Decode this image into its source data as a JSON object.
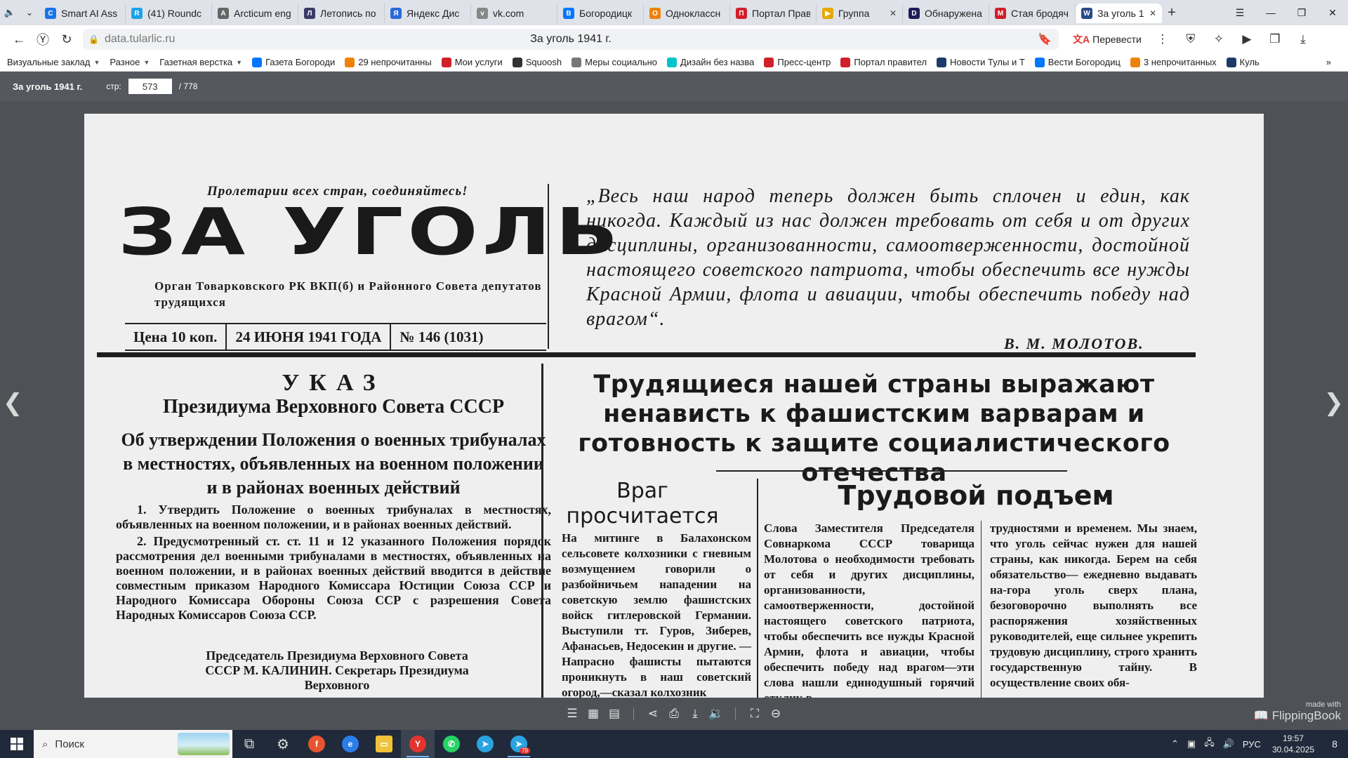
{
  "browser": {
    "tabs": [
      {
        "title": "Smart AI Ass",
        "icon_color": "#1a73e8",
        "icon": "C"
      },
      {
        "title": "(41) Roundc",
        "icon_color": "#1aa3e8",
        "icon": "R"
      },
      {
        "title": "Arcticum eng",
        "icon_color": "#666666",
        "icon": "A"
      },
      {
        "title": "Летопись по",
        "icon_color": "#3a3a6a",
        "icon": "Л"
      },
      {
        "title": "Яндекс Дис",
        "icon_color": "#2a6ad8",
        "icon": "Я"
      },
      {
        "title": "vk.com",
        "icon_color": "#888888",
        "icon": "v"
      },
      {
        "title": "Богородицк",
        "icon_color": "#0077ff",
        "icon": "В"
      },
      {
        "title": "Одноклассн",
        "icon_color": "#ee8208",
        "icon": "О"
      },
      {
        "title": "Портал Прав",
        "icon_color": "#d0202a",
        "icon": "П"
      },
      {
        "title": "Группа",
        "icon_color": "#e5a800",
        "icon": "▶"
      },
      {
        "title": "Обнаружена",
        "icon_color": "#1d1d5a",
        "icon": "D"
      },
      {
        "title": "Стая бродяч",
        "icon_color": "#d0202a",
        "icon": "M"
      },
      {
        "title": "За уголь 1",
        "icon_color": "#2a4a8a",
        "icon": "W"
      }
    ],
    "window_controls": {
      "menu": "☰",
      "minimize": "—",
      "restore": "❐",
      "close": "✕"
    },
    "address": {
      "url": "data.tularlic.ru",
      "page_title": "За уголь 1941 г.",
      "translate_label": "Перевести"
    },
    "bookmarks": [
      {
        "label": "Визуальные заклад",
        "dropdown": true,
        "icon_color": ""
      },
      {
        "label": "Разное",
        "dropdown": true,
        "icon_color": ""
      },
      {
        "label": "Газетная верстка",
        "dropdown": true,
        "icon_color": ""
      },
      {
        "label": "Газета Богороди",
        "dropdown": false,
        "icon_color": "#0077ff"
      },
      {
        "label": "29 непрочитанны",
        "dropdown": false,
        "icon_color": "#ee8208"
      },
      {
        "label": "Мои услуги",
        "dropdown": false,
        "icon_color": "#d0202a"
      },
      {
        "label": "Squoosh",
        "dropdown": false,
        "icon_color": "#333333"
      },
      {
        "label": "Меры социально",
        "dropdown": false,
        "icon_color": "#777777"
      },
      {
        "label": "Дизайн без назва",
        "dropdown": false,
        "icon_color": "#00c4cc"
      },
      {
        "label": "Пресс-центр",
        "dropdown": false,
        "icon_color": "#d0202a"
      },
      {
        "label": "Портал правител",
        "dropdown": false,
        "icon_color": "#d0202a"
      },
      {
        "label": "Новости Тулы и Т",
        "dropdown": false,
        "icon_color": "#1d3a6a"
      },
      {
        "label": "Вести Богородиц",
        "dropdown": false,
        "icon_color": "#0077ff"
      },
      {
        "label": "3 непрочитанных",
        "dropdown": false,
        "icon_color": "#ee8208"
      },
      {
        "label": "Куль",
        "dropdown": false,
        "icon_color": "#1d3a6a"
      }
    ]
  },
  "viewer": {
    "doc_title": "За уголь 1941 г.",
    "page_label": "стр:",
    "current_page": "573",
    "total_pages": "/ 778",
    "made_with": "made with",
    "brand": "FlippingBook"
  },
  "newspaper": {
    "motto": "Пролетарии всех стран, соединяйтесь!",
    "masthead": "ЗА УГОЛЬ",
    "organ": "Орган Товарковского РК ВКП(б) и Районного Совета депутатов трудящихся",
    "price": "Цена 10 коп.",
    "date": "24 ИЮНЯ 1941 ГОДА",
    "issue": "№ 146 (1031)",
    "quote": "„Весь наш народ теперь должен быть сплочен и един, как никогда. Каждый из нас должен требовать от себя и от других дисциплины, организованности, самоотверженности, достойной настоящего советского патриота, чтобы обеспечить все нужды Красной Армии, флота и авиации, чтобы обеспечить победу над врагом“.",
    "quote_author": "В. М. МОЛОТОВ.",
    "ukaz_title": "УКАЗ",
    "ukaz_subtitle": "Президиума Верховного Совета СССР",
    "ukaz_heading": "Об утверждении Положения о военных трибуналах в местностях, объявленных на военном положении и в районах военных действий",
    "ukaz_p1": "1. Утвердить Положение о военных трибуналах в местностях, объявленных на военном положении, и в районах военных действий.",
    "ukaz_p2": "2. Предусмотренный ст. ст. 11 и 12 указанного Положения порядок рассмотрения дел военными трибуналами в местностях, объявленных на военном положении, и в районах военных действий вводится в действие совместным приказом Народного Комиссара Юстиции Союза ССР и Народного Комиссара Обороны Союза ССР с разрешения Совета Народных Комиссаров Союза ССР.",
    "ukaz_sign": "Председатель Президиума Верховного Совета СССР М. КАЛИНИН. Секретарь Президиума Верховного",
    "main_headline": "Трудящиеся нашей страны выражают ненависть к фашистским варварам и готовность к защите социалистического отечества",
    "vrag_title": "Враг просчитается",
    "vrag_body": "На митинге в Балахонском сельсовете колхозники с гневным возмущением говорили о разбойничьем нападении на советскую землю фашистских войск гитлеровской Германии. Выступили тт. Гуров, Зиберев, Афанасьев, Недосекин и другие. —Напрасно фашисты пытаются проникнуть в наш советский огород,—сказал колхозник",
    "trud_title": "Трудовой подъем",
    "trud_body_1": "Слова Заместителя Председателя Совнаркома СССР товарища Молотова о необходимости требовать от себя и других дисциплины, организованности, самоотверженности, достойной настоящего советского патриота, чтобы обеспечить все нужды Красной Армии, флота и авиации, чтобы обеспечить победу над врагом—эти слова нашли единодушный горячий отклик в",
    "trud_body_2": "трудностями и временем. Мы знаем, что уголь сейчас нужен для нашей страны, как никогда. Берем на себя обязательство— ежедневно выдавать на-гора уголь сверх плана, безоговорочно выполнять все распоряжения хозяйственных руководителей, еще сильнее укрепить трудовую дисциплину, строго хранить государственную тайну. В осуществление своих обя-"
  },
  "taskbar": {
    "search_placeholder": "Поиск",
    "language": "РУС",
    "time": "19:57",
    "date": "30.04.2025",
    "notification_count": "8",
    "telegram_badge": "79"
  }
}
